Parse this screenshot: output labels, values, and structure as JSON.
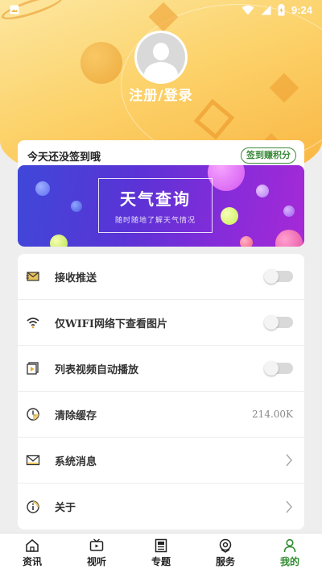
{
  "status_bar": {
    "time": "9:24"
  },
  "profile": {
    "login_label": "注册/登录"
  },
  "checkin": {
    "title": "今天还没签到哦",
    "button": "签到赚积分",
    "banner_title": "天气查询",
    "banner_subtitle": "随时随地了解天气情况"
  },
  "settings": [
    {
      "label": "接收推送",
      "icon": "envelope-icon",
      "control": "toggle"
    },
    {
      "label": "仅WIFI网络下查看图片",
      "icon": "wifi-icon",
      "control": "toggle"
    },
    {
      "label": "列表视频自动播放",
      "icon": "video-icon",
      "control": "toggle"
    },
    {
      "label": "清除缓存",
      "icon": "clock-icon",
      "control": "value",
      "value": "214.00K"
    },
    {
      "label": "系统消息",
      "icon": "mail-icon",
      "control": "chevron"
    },
    {
      "label": "关于",
      "icon": "info-icon",
      "control": "chevron"
    }
  ],
  "nav": [
    {
      "label": "资讯",
      "icon": "home-icon"
    },
    {
      "label": "视听",
      "icon": "tv-icon"
    },
    {
      "label": "专题",
      "icon": "newspaper-icon"
    },
    {
      "label": "服务",
      "icon": "service-icon"
    },
    {
      "label": "我的",
      "icon": "user-icon",
      "active": true
    }
  ],
  "colors": {
    "accent": "#2e8b2e",
    "header": "#fcd26a"
  }
}
